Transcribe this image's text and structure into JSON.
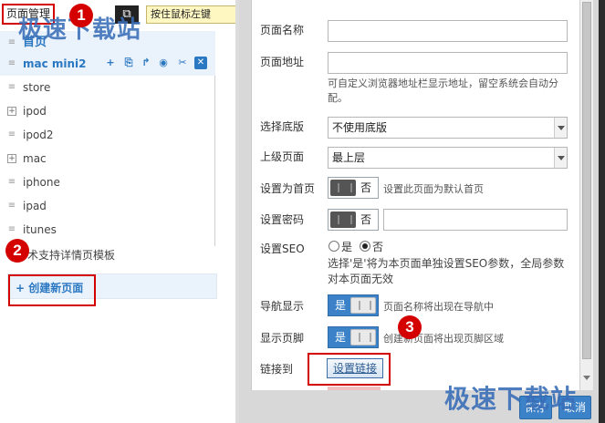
{
  "toolbar": {
    "tab_label": "页面管理",
    "copy_icon": "copy-icon",
    "tooltip": "按住鼠标左键"
  },
  "markers": {
    "one": "1",
    "two": "2",
    "three": "3"
  },
  "watermark": "极速下载站",
  "tree": {
    "home": "首页",
    "selected": "mac mini2",
    "items": [
      "store",
      "ipod",
      "ipod2",
      "mac",
      "iphone",
      "ipad",
      "itunes"
    ],
    "template": "术支持详情页模板",
    "actions": {
      "add": "+",
      "delete": "✕"
    }
  },
  "create_button": "+ 创建新页面",
  "form": {
    "page_name_label": "页面名称",
    "page_address_label": "页面地址",
    "page_address_hint": "可自定义浏览器地址栏显示地址，留空系统会自动分配。",
    "base_label": "选择底版",
    "base_value": "不使用底版",
    "parent_label": "上级页面",
    "parent_value": "最上层",
    "homepage_label": "设置为首页",
    "homepage_toggle": "否",
    "homepage_hint": "设置此页面为默认首页",
    "password_label": "设置密码",
    "password_toggle": "否",
    "seo_label": "设置SEO",
    "seo_yes": "是",
    "seo_no": "否",
    "seo_hint": "选择'是'将为本页面单独设置SEO参数，全局参数对本页面无效",
    "nav_label": "导航显示",
    "nav_toggle": "是",
    "nav_hint": "页面名称将出现在导航中",
    "footer_label": "显示页脚",
    "footer_toggle": "是",
    "footer_hint": "创建新页面将出现页脚区域",
    "link_label": "链接到",
    "link_button": "设置链接"
  },
  "footer": {
    "save": "保存",
    "cancel": "取消"
  },
  "colors": {
    "accent": "#3b82c8",
    "highlight": "#d40000",
    "selected_bg": "#eaf2fb"
  }
}
